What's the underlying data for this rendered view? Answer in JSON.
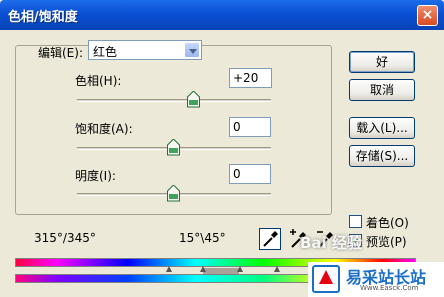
{
  "window": {
    "title": "色相/饱和度",
    "close_label": "×"
  },
  "edit": {
    "label": "编辑(E):",
    "value": "红色"
  },
  "hue": {
    "label": "色相(H):",
    "value": "+20",
    "level": 0.55
  },
  "saturation": {
    "label": "饱和度(A):",
    "value": "0",
    "level": 0.5
  },
  "lightness": {
    "label": "明度(I):",
    "value": "0",
    "level": 0.5
  },
  "buttons": {
    "ok": "好",
    "cancel": "取消",
    "load": "载入(L)...",
    "save": "存储(S)..."
  },
  "colorize": {
    "label": "着色(O)",
    "checked": false
  },
  "preview": {
    "label": "预览(P)",
    "checked": true
  },
  "range": {
    "left": "315°/345°",
    "right": "15°\\45°"
  },
  "icons": {
    "eyedropper": "eyedropper-icon",
    "eyedropper_add": "eyedropper-plus-icon",
    "eyedropper_subtract": "eyedropper-minus-icon"
  },
  "watermark": {
    "text": "Bai 经验"
  },
  "logo": {
    "name": "易采站长站",
    "url": "Www.Easck.Com"
  },
  "colors": {
    "title_bar": "#0a50d4",
    "dialog": "#ece9d8",
    "button_border": "#003c74"
  }
}
